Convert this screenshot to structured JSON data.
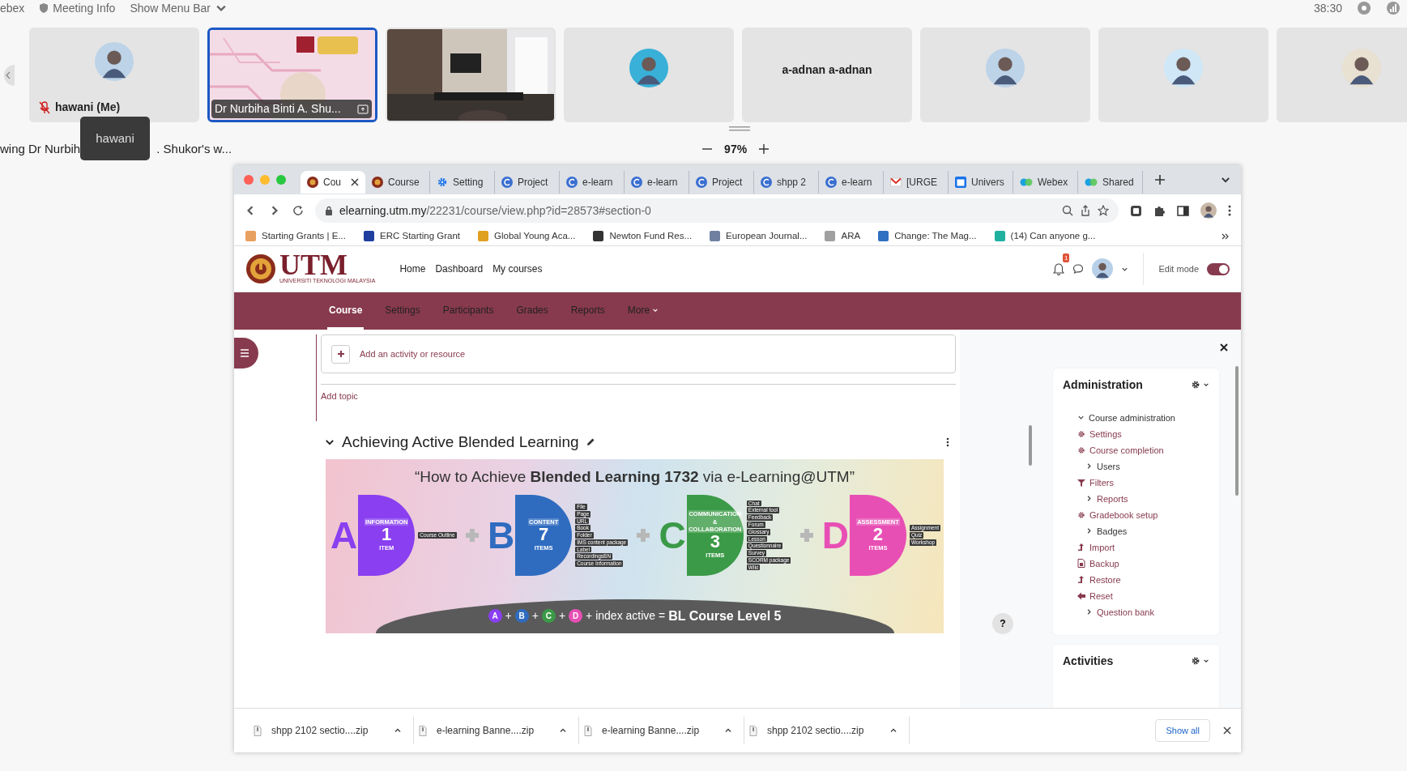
{
  "meeting_bar": {
    "app": "ebex",
    "info": "Meeting Info",
    "menu": "Show Menu Bar",
    "time": "38:30"
  },
  "participants": [
    {
      "kind": "avatar",
      "name": "hawani (Me)",
      "muted": true,
      "selected": false
    },
    {
      "kind": "share",
      "name": "Dr Nurbiha Binti A. Shu...",
      "muted": false,
      "selected": true
    },
    {
      "kind": "video",
      "muted": false,
      "selected": false
    },
    {
      "kind": "avatar",
      "muted": false,
      "selected": false
    },
    {
      "kind": "name",
      "name": "a-adnan a-adnan",
      "muted": false,
      "selected": false
    },
    {
      "kind": "avatar",
      "muted": false,
      "selected": false
    },
    {
      "kind": "avatar",
      "muted": false,
      "selected": false
    },
    {
      "kind": "avatar",
      "muted": false,
      "selected": false
    }
  ],
  "share_label": {
    "before": "wing Dr Nurbih",
    "after": ". Shukor's w...",
    "tooltip": "hawani"
  },
  "zoom": {
    "value": "97%"
  },
  "browser": {
    "tabs": [
      {
        "label": "Cou",
        "kind": "utm",
        "selected": true
      },
      {
        "label": "Course",
        "kind": "utm",
        "selected": false
      },
      {
        "label": "Setting",
        "kind": "gear",
        "selected": false
      },
      {
        "label": "Project",
        "kind": "c",
        "selected": false
      },
      {
        "label": "e-learn",
        "kind": "c",
        "selected": false
      },
      {
        "label": "e-learn",
        "kind": "c",
        "selected": false
      },
      {
        "label": "Project",
        "kind": "c",
        "selected": false
      },
      {
        "label": "shpp 2",
        "kind": "c",
        "selected": false
      },
      {
        "label": "e-learn",
        "kind": "c",
        "selected": false
      },
      {
        "label": "[URGE",
        "kind": "mail",
        "selected": false
      },
      {
        "label": "Univers",
        "kind": "calendar",
        "selected": false
      },
      {
        "label": "Webex",
        "kind": "webex",
        "selected": false
      },
      {
        "label": "Shared",
        "kind": "webex",
        "selected": false
      }
    ],
    "url": {
      "host": "elearning.utm.my",
      "path": "/22231/course/view.php?id=28573#section-0"
    },
    "bookmarks": [
      {
        "label": "Starting Grants | E...",
        "color": "#e8a060"
      },
      {
        "label": "ERC Starting Grant",
        "color": "#1f3f9f"
      },
      {
        "label": "Global Young Aca...",
        "color": "#e0a020"
      },
      {
        "label": "Newton Fund Res...",
        "color": "#333333"
      },
      {
        "label": "European Journal...",
        "color": "#7080a0"
      },
      {
        "label": "ARA",
        "color": "#a0a0a0"
      },
      {
        "label": "Change: The Mag...",
        "color": "#3070c0"
      },
      {
        "label": "(14) Can anyone g...",
        "color": "#20b0a0"
      }
    ]
  },
  "site": {
    "logo": "UTM",
    "logo_sub": "UNIVERSITI TEKNOLOGI MALAYSIA",
    "nav": [
      "Home",
      "Dashboard",
      "My courses"
    ],
    "notifications": "1",
    "edit_mode": {
      "label": "Edit mode",
      "on": true
    },
    "course_nav": [
      {
        "label": "Course",
        "selected": true
      },
      {
        "label": "Settings",
        "selected": false
      },
      {
        "label": "Participants",
        "selected": false
      },
      {
        "label": "Grades",
        "selected": false
      },
      {
        "label": "Reports",
        "selected": false
      },
      {
        "label": "More",
        "selected": false
      }
    ]
  },
  "content": {
    "add_activity": "Add an activity or resource",
    "add_topic": "Add topic",
    "section_title": "Achieving Active Blended Learning",
    "banner": {
      "title": "“How to Achieve **Blended Learning 1732** via e-Learning@UTM”",
      "groups": [
        {
          "letter": "A",
          "label": "INFORMATION",
          "count": "1",
          "unit": "ITEM",
          "color": "#8a3ff0",
          "items": [
            "Course Outline"
          ]
        },
        {
          "letter": "B",
          "label": "CONTENT",
          "count": "7",
          "unit": "ITEMS",
          "color": "#2f6cc0",
          "items": [
            "File",
            "Page",
            "URL",
            "Book",
            "Folder",
            "IMS content package",
            "Label",
            "RecordingsBN",
            "Course Information"
          ]
        },
        {
          "letter": "C",
          "label": "COMMUNICATION & COLLABORATION",
          "count": "3",
          "unit": "ITEMS",
          "color": "#3b9a47",
          "items": [
            "Chat",
            "External tool",
            "Feedback",
            "Forum",
            "Glossary",
            "Lesson",
            "Questionnaire",
            "Survey",
            "SCORM package",
            "Wiki"
          ]
        },
        {
          "letter": "D",
          "label": "ASSESSMENT",
          "count": "2",
          "unit": "ITEMS",
          "color": "#e84fb5",
          "items": [
            "Assignment",
            "Quiz",
            "Workshop"
          ]
        }
      ],
      "footer": {
        "letters": [
          {
            "letter": "A",
            "color": "#8a3ff0"
          },
          {
            "letter": "B",
            "color": "#2f6cc0"
          },
          {
            "letter": "C",
            "color": "#3b9a47"
          },
          {
            "letter": "D",
            "color": "#e84fb5"
          }
        ],
        "joiner": "+",
        "text": "+ index active =",
        "result": "BL Course Level 5"
      }
    }
  },
  "admin": {
    "title": "Administration",
    "items": [
      {
        "label": "Course administration",
        "kind": "branch",
        "expanded": true,
        "linked": false,
        "children": [
          {
            "label": "Settings",
            "kind": "gear"
          },
          {
            "label": "Course completion",
            "kind": "gear"
          },
          {
            "label": "Users",
            "kind": "branch",
            "expanded": false,
            "linked": false
          },
          {
            "label": "Filters",
            "kind": "filter"
          },
          {
            "label": "Reports",
            "kind": "branch",
            "expanded": false,
            "linked": true
          },
          {
            "label": "Gradebook setup",
            "kind": "gear"
          },
          {
            "label": "Badges",
            "kind": "branch",
            "expanded": false,
            "linked": false
          },
          {
            "label": "Import",
            "kind": "upload"
          },
          {
            "label": "Backup",
            "kind": "file"
          },
          {
            "label": "Restore",
            "kind": "upload"
          },
          {
            "label": "Reset",
            "kind": "back"
          },
          {
            "label": "Question bank",
            "kind": "branch",
            "expanded": false,
            "linked": true
          }
        ]
      }
    ]
  },
  "activities": {
    "title": "Activities"
  },
  "help": "?",
  "downloads": {
    "files": [
      "shpp 2102 sectio....zip",
      "e-learning Banne....zip",
      "e-learning Banne....zip",
      "shpp 2102 sectio....zip"
    ],
    "show_all": "Show all"
  }
}
